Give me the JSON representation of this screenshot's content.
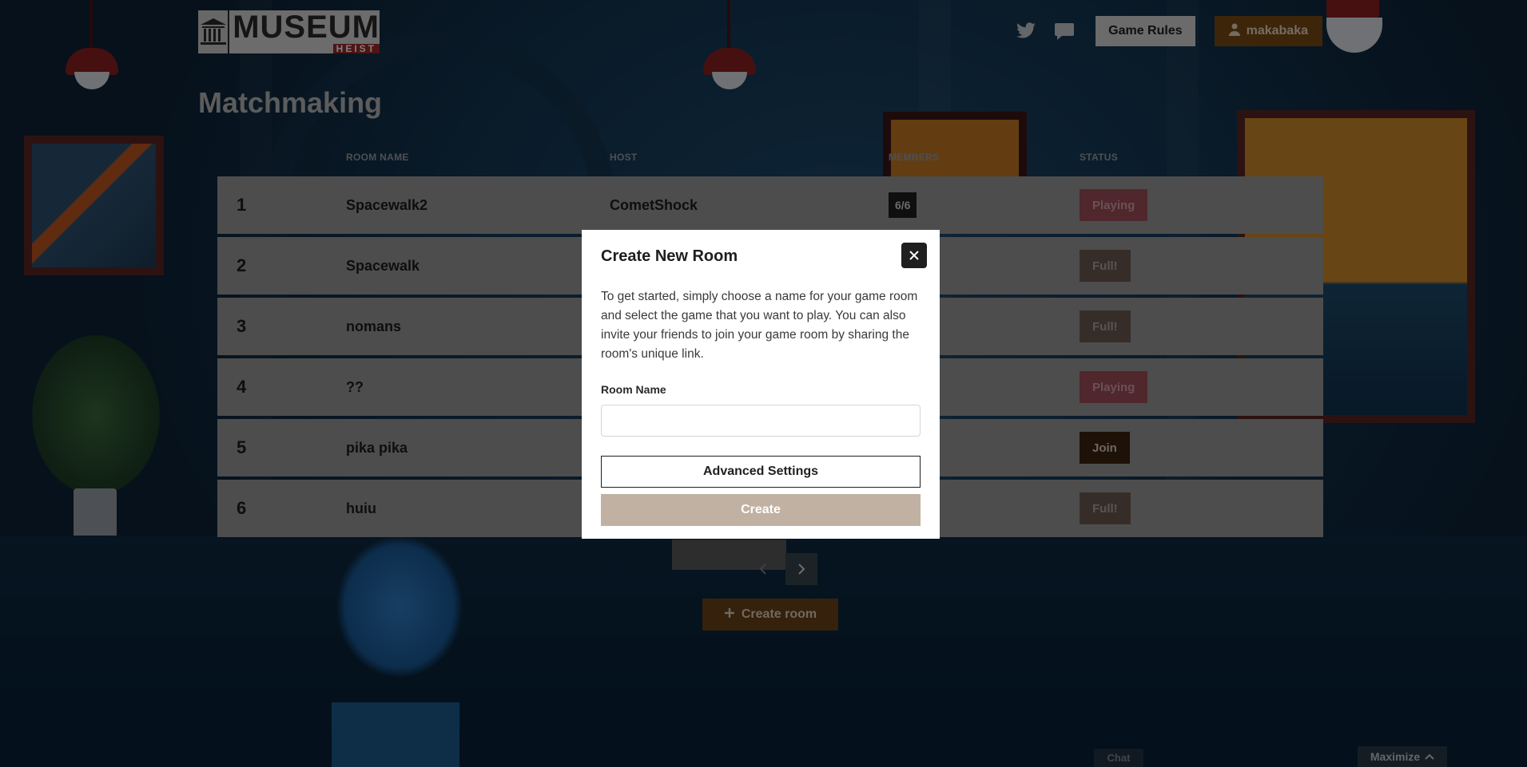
{
  "header": {
    "logo_main": "MUSEUM",
    "logo_sub": "HEIST",
    "twitter_icon": "twitter-icon",
    "chat_icon": "speech-bubble-icon",
    "rules_label": "Game Rules",
    "user_label": "makabaka",
    "user_icon": "user-icon"
  },
  "page": {
    "title": "Matchmaking"
  },
  "table": {
    "columns": [
      "ROOM NAME",
      "HOST",
      "MEMBERS",
      "STATUS"
    ],
    "rows": [
      {
        "num": "1",
        "name": "Spacewalk2",
        "host": "CometShock",
        "members": "6/6",
        "status": "Playing"
      },
      {
        "num": "2",
        "name": "Spacewalk",
        "host": "",
        "members": "",
        "status": "Full!"
      },
      {
        "num": "3",
        "name": "nomans",
        "host": "",
        "members": "",
        "status": "Full!"
      },
      {
        "num": "4",
        "name": "??",
        "host": "",
        "members": "",
        "status": "Playing"
      },
      {
        "num": "5",
        "name": "pika pika",
        "host": "",
        "members": "",
        "status": "Join"
      },
      {
        "num": "6",
        "name": "huiu",
        "host": "",
        "members": "",
        "status": "Full!"
      }
    ]
  },
  "pager": {
    "prev_icon": "chevron-left-icon",
    "next_icon": "chevron-right-icon"
  },
  "create_room_label": "Create room",
  "chat_tab_label": "Chat",
  "maximize_label": "Maximize",
  "modal": {
    "title": "Create New Room",
    "description": "To get started, simply choose a name for your game room and select the game that you want to play. You can also invite your friends to join your game room by sharing the room's unique link.",
    "room_name_label": "Room Name",
    "room_name_value": "",
    "room_name_placeholder": "",
    "advanced_label": "Advanced Settings",
    "create_label": "Create"
  },
  "colors": {
    "status_playing": "#a04e58",
    "status_full": "#6d5a52",
    "status_join": "#3d2410",
    "accent_brown": "#7a4a12",
    "create_button": "#c0b1a2"
  }
}
